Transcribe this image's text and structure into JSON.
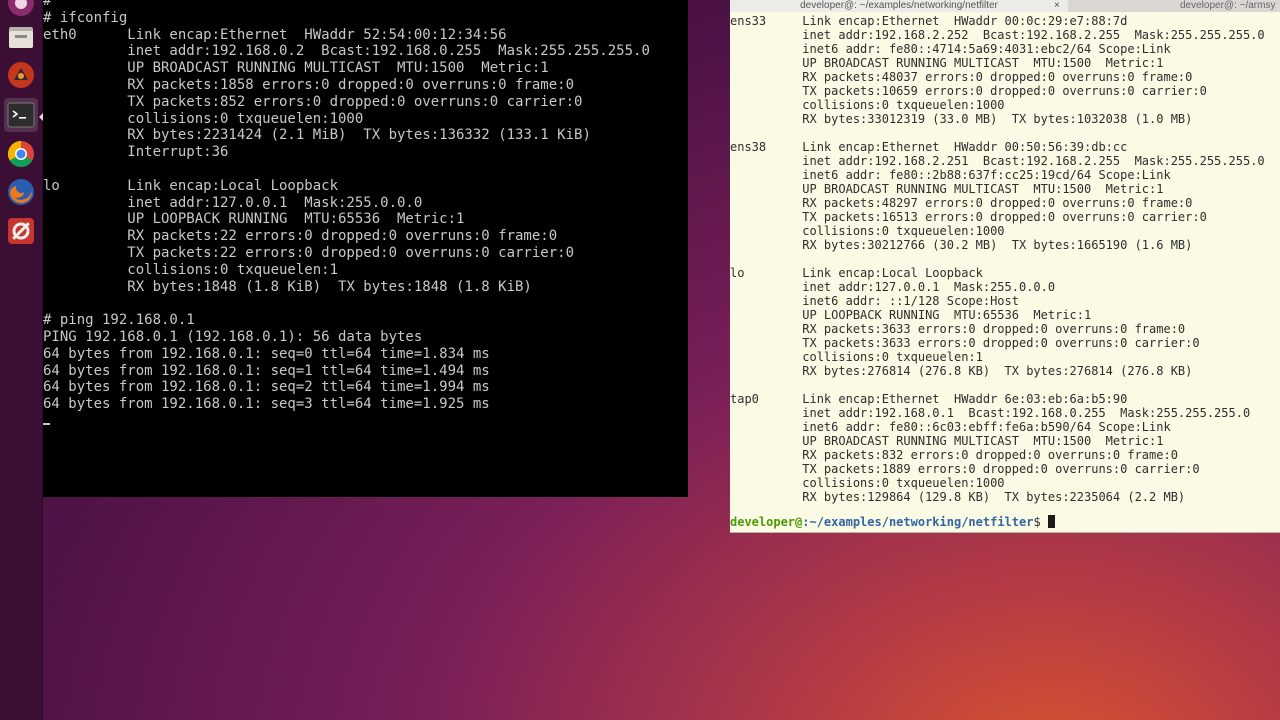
{
  "launcher": {
    "items": [
      {
        "name": "settings-app-icon"
      },
      {
        "name": "files-icon"
      },
      {
        "name": "remmina-icon"
      },
      {
        "name": "terminal-icon"
      },
      {
        "name": "chrome-icon"
      },
      {
        "name": "firefox-icon"
      },
      {
        "name": "system-settings-icon"
      }
    ]
  },
  "console": {
    "lines": [
      "#",
      "# ifconfig",
      "eth0      Link encap:Ethernet  HWaddr 52:54:00:12:34:56",
      "          inet addr:192.168.0.2  Bcast:192.168.0.255  Mask:255.255.255.0",
      "          UP BROADCAST RUNNING MULTICAST  MTU:1500  Metric:1",
      "          RX packets:1858 errors:0 dropped:0 overruns:0 frame:0",
      "          TX packets:852 errors:0 dropped:0 overruns:0 carrier:0",
      "          collisions:0 txqueuelen:1000",
      "          RX bytes:2231424 (2.1 MiB)  TX bytes:136332 (133.1 KiB)",
      "          Interrupt:36",
      "",
      "lo        Link encap:Local Loopback",
      "          inet addr:127.0.0.1  Mask:255.0.0.0",
      "          UP LOOPBACK RUNNING  MTU:65536  Metric:1",
      "          RX packets:22 errors:0 dropped:0 overruns:0 frame:0",
      "          TX packets:22 errors:0 dropped:0 overruns:0 carrier:0",
      "          collisions:0 txqueuelen:1",
      "          RX bytes:1848 (1.8 KiB)  TX bytes:1848 (1.8 KiB)",
      "",
      "# ping 192.168.0.1",
      "PING 192.168.0.1 (192.168.0.1): 56 data bytes",
      "64 bytes from 192.168.0.1: seq=0 ttl=64 time=1.834 ms",
      "64 bytes from 192.168.0.1: seq=1 ttl=64 time=1.494 ms",
      "64 bytes from 192.168.0.1: seq=2 ttl=64 time=1.994 ms",
      "64 bytes from 192.168.0.1: seq=3 ttl=64 time=1.925 ms"
    ]
  },
  "terminal": {
    "tab_active": "developer@: ~/examples/networking/netfilter",
    "tab_close": "×",
    "tab_inactive": "developer@: ~/armsy",
    "lines": [
      "ens33     Link encap:Ethernet  HWaddr 00:0c:29:e7:88:7d",
      "          inet addr:192.168.2.252  Bcast:192.168.2.255  Mask:255.255.255.0",
      "          inet6 addr: fe80::4714:5a69:4031:ebc2/64 Scope:Link",
      "          UP BROADCAST RUNNING MULTICAST  MTU:1500  Metric:1",
      "          RX packets:48037 errors:0 dropped:0 overruns:0 frame:0",
      "          TX packets:10659 errors:0 dropped:0 overruns:0 carrier:0",
      "          collisions:0 txqueuelen:1000",
      "          RX bytes:33012319 (33.0 MB)  TX bytes:1032038 (1.0 MB)",
      "",
      "ens38     Link encap:Ethernet  HWaddr 00:50:56:39:db:cc",
      "          inet addr:192.168.2.251  Bcast:192.168.2.255  Mask:255.255.255.0",
      "          inet6 addr: fe80::2b88:637f:cc25:19cd/64 Scope:Link",
      "          UP BROADCAST RUNNING MULTICAST  MTU:1500  Metric:1",
      "          RX packets:48297 errors:0 dropped:0 overruns:0 frame:0",
      "          TX packets:16513 errors:0 dropped:0 overruns:0 carrier:0",
      "          collisions:0 txqueuelen:1000",
      "          RX bytes:30212766 (30.2 MB)  TX bytes:1665190 (1.6 MB)",
      "",
      "lo        Link encap:Local Loopback",
      "          inet addr:127.0.0.1  Mask:255.0.0.0",
      "          inet6 addr: ::1/128 Scope:Host",
      "          UP LOOPBACK RUNNING  MTU:65536  Metric:1",
      "          RX packets:3633 errors:0 dropped:0 overruns:0 frame:0",
      "          TX packets:3633 errors:0 dropped:0 overruns:0 carrier:0",
      "          collisions:0 txqueuelen:1",
      "          RX bytes:276814 (276.8 KB)  TX bytes:276814 (276.8 KB)",
      "",
      "tap0      Link encap:Ethernet  HWaddr 6e:03:eb:6a:b5:90",
      "          inet addr:192.168.0.1  Bcast:192.168.0.255  Mask:255.255.255.0",
      "          inet6 addr: fe80::6c03:ebff:fe6a:b590/64 Scope:Link",
      "          UP BROADCAST RUNNING MULTICAST  MTU:1500  Metric:1",
      "          RX packets:832 errors:0 dropped:0 overruns:0 frame:0",
      "          TX packets:1889 errors:0 dropped:0 overruns:0 carrier:0",
      "          collisions:0 txqueuelen:1000",
      "          RX bytes:129864 (129.8 KB)  TX bytes:2235064 (2.2 MB)"
    ],
    "prompt": {
      "user": "developer@",
      "path": ":~/examples/networking/netfilter",
      "symbol": "$ "
    }
  }
}
